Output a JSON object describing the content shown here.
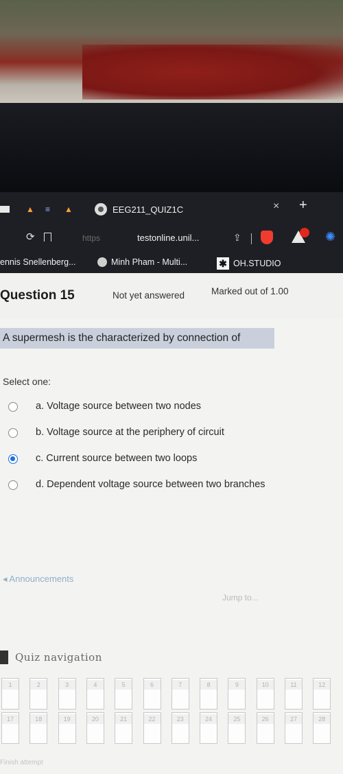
{
  "browser": {
    "tab_title": "EEG211_QUIZ1C",
    "close_label": "×",
    "new_tab_label": "+",
    "url_scheme": "https",
    "url_host": "testonline.unil...",
    "bookmarks": [
      {
        "label": "ennis Snellenberg..."
      },
      {
        "label": "Minh Pham - Multi..."
      },
      {
        "label": "OH.STUDIO"
      }
    ]
  },
  "question": {
    "title": "Question 15",
    "status": "Not yet answered",
    "mark": "Marked out of 1.00",
    "text": "A supermesh is the characterized by connection of",
    "prompt": "Select one:",
    "options": [
      {
        "label": "a. Voltage source between two nodes",
        "checked": false
      },
      {
        "label": "b. Voltage source at the periphery of circuit",
        "checked": false
      },
      {
        "label": "c. Current source between two loops",
        "checked": true
      },
      {
        "label": "d. Dependent voltage source between two branches",
        "checked": false
      }
    ]
  },
  "nav": {
    "prev_link": "◂ Announcements",
    "jump_to": "Jump to...",
    "quiz_nav_title": "Quiz navigation",
    "buttons": [
      "1",
      "2",
      "3",
      "4",
      "5",
      "6",
      "7",
      "8",
      "9",
      "10",
      "11",
      "12",
      "17",
      "18",
      "19",
      "20",
      "21",
      "22",
      "23",
      "24",
      "25",
      "26",
      "27",
      "28"
    ],
    "finish": "Finish attempt"
  }
}
